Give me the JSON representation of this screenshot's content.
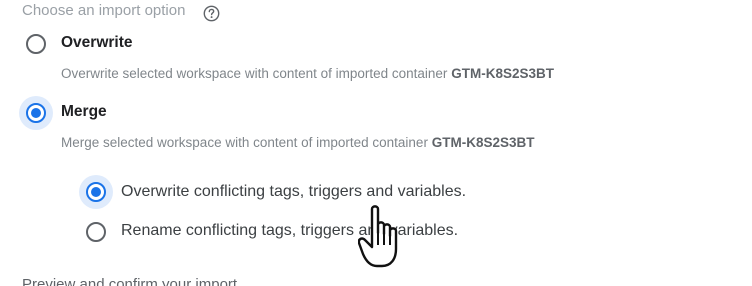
{
  "import_options": {
    "label": "Choose an import option",
    "help_icon": "help-circle-icon",
    "overwrite": {
      "title": "Overwrite",
      "description_prefix": "Overwrite selected workspace with content of imported container",
      "container_id": "GTM-K8S2S3BT",
      "selected": false
    },
    "merge": {
      "title": "Merge",
      "description_prefix": "Merge selected workspace with content of imported container",
      "container_id": "GTM-K8S2S3BT",
      "selected": true,
      "sub_options": [
        {
          "label": "Overwrite conflicting tags, triggers and variables.",
          "selected": true
        },
        {
          "label": "Rename conflicting tags, triggers and variables.",
          "selected": false
        }
      ]
    }
  },
  "next_section": {
    "label": "Preview and confirm your import"
  },
  "pointer_icon": "hand-pointer-icon",
  "colors": {
    "accent": "#1a73e8",
    "muted_text": "#80868b",
    "title_text": "#202124"
  }
}
